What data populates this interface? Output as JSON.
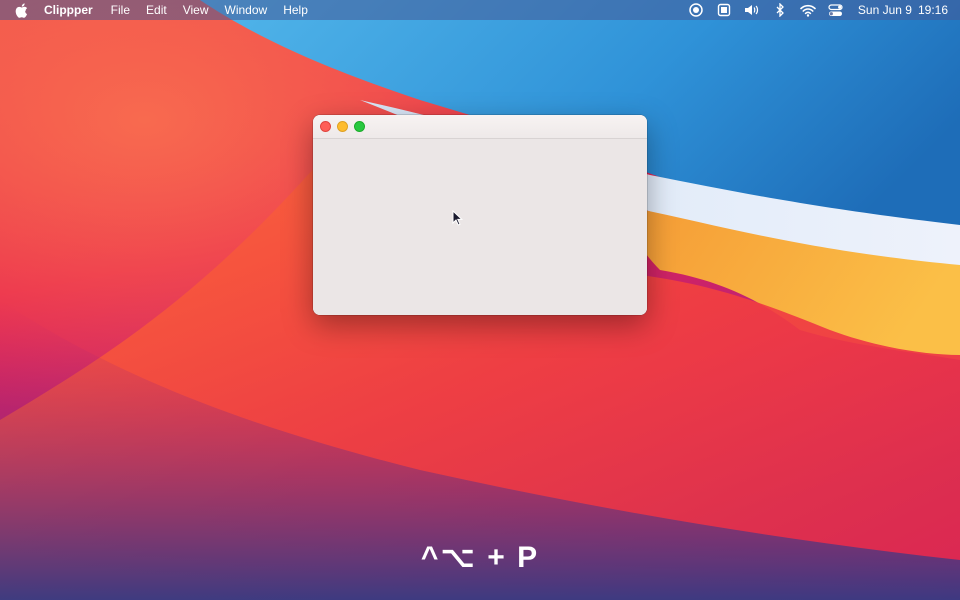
{
  "menubar": {
    "apple_icon": "apple-logo-icon",
    "app_name": "Clippper",
    "menus": [
      "File",
      "Edit",
      "View",
      "Window",
      "Help"
    ],
    "status_icons": [
      "screen-record-icon",
      "screen-capture-icon",
      "volume-icon",
      "bluetooth-icon",
      "wifi-icon",
      "control-center-icon"
    ],
    "date": "Sun Jun 9",
    "time": "19:16"
  },
  "window": {
    "controls": [
      "close",
      "minimize",
      "zoom"
    ],
    "control_colors": {
      "close": "#fe5f57",
      "minimize": "#febc2e",
      "zoom": "#28c840"
    },
    "background": "#ebe6e6"
  },
  "shortcut": {
    "text": "^⌥ + P"
  },
  "colors": {
    "wallpaper_red": "#e8224f",
    "wallpaper_blue": "#2a8fd6",
    "wallpaper_orange": "#f7a535"
  }
}
